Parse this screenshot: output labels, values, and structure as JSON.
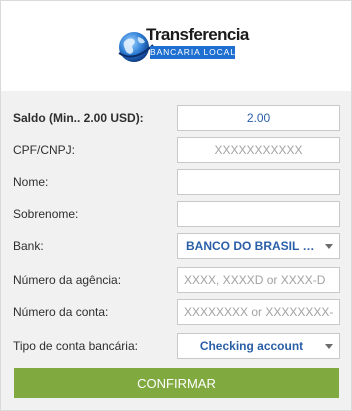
{
  "logo": {
    "title": "Transferencia",
    "subtitle": "BANCARIA LOCAL"
  },
  "form": {
    "saldo": {
      "label": "Saldo (Min.. 2.00 USD):",
      "value": "2.00"
    },
    "cpf": {
      "label": "CPF/CNPJ:",
      "placeholder": "XXXXXXXXXXX"
    },
    "nome": {
      "label": "Nome:",
      "value": ""
    },
    "sobrenome": {
      "label": "Sobrenome:",
      "value": ""
    },
    "bank": {
      "label": "Bank:",
      "selected": "BANCO DO BRASIL S.A."
    },
    "agencia": {
      "label": "Número da agência:",
      "placeholder": "XXXX, XXXXD or XXXX-D"
    },
    "conta": {
      "label": "Número da conta:",
      "placeholder": "XXXXXXXX or XXXXXXXX-D"
    },
    "tipo": {
      "label": "Tipo de conta bancária:",
      "selected": "Checking account"
    }
  },
  "confirm_label": "CONFIRMAR",
  "colors": {
    "accent_text": "#2a5fa8",
    "confirm_button": "#80a93f",
    "logo_band": "#1e6fd0"
  },
  "icons": {
    "logo": "globe-logo-icon",
    "dropdown": "chevron-down-icon"
  }
}
